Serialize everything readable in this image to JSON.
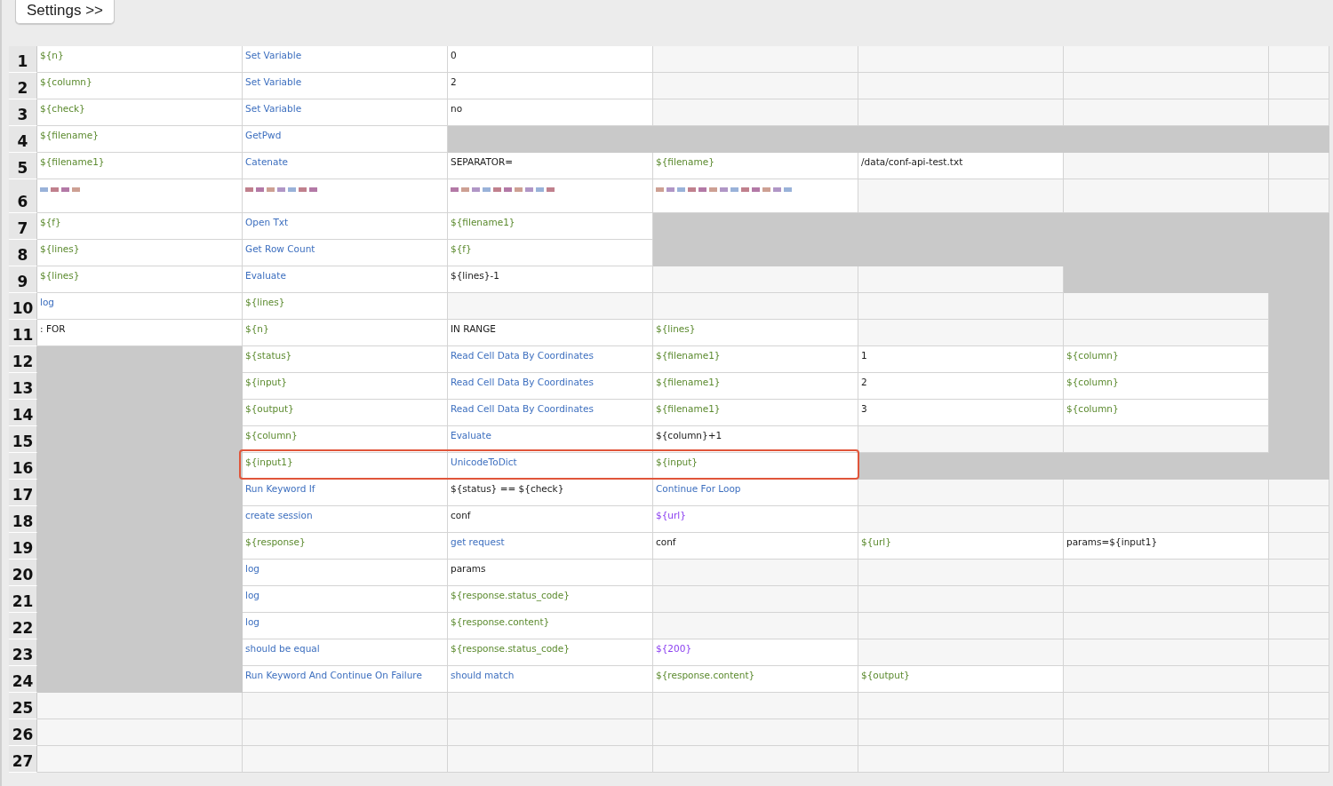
{
  "settings_button": "Settings >>",
  "rows": [
    {
      "number": "1",
      "cells": [
        {
          "text": "${n}",
          "kind": "variable",
          "shaded": false,
          "highlighted": false
        },
        {
          "text": "Set Variable",
          "kind": "keyword",
          "shaded": false,
          "highlighted": false
        },
        {
          "text": "0",
          "kind": "plain",
          "shaded": false,
          "highlighted": false
        },
        {
          "shaded": false,
          "highlighted": false
        },
        {
          "shaded": false,
          "highlighted": false
        },
        {
          "shaded": false,
          "highlighted": false
        },
        {
          "shaded": false,
          "highlighted": false
        }
      ]
    },
    {
      "number": "2",
      "cells": [
        {
          "text": "${column}",
          "kind": "variable",
          "shaded": false,
          "highlighted": false
        },
        {
          "text": "Set Variable",
          "kind": "keyword",
          "shaded": false,
          "highlighted": false
        },
        {
          "text": "2",
          "kind": "plain",
          "shaded": false,
          "highlighted": false
        },
        {
          "shaded": false,
          "highlighted": false
        },
        {
          "shaded": false,
          "highlighted": false
        },
        {
          "shaded": false,
          "highlighted": false
        },
        {
          "shaded": false,
          "highlighted": false
        }
      ]
    },
    {
      "number": "3",
      "cells": [
        {
          "text": "${check}",
          "kind": "variable",
          "shaded": false,
          "highlighted": false
        },
        {
          "text": "Set Variable",
          "kind": "keyword",
          "shaded": false,
          "highlighted": false
        },
        {
          "text": "no",
          "kind": "plain",
          "shaded": false,
          "highlighted": false
        },
        {
          "shaded": false,
          "highlighted": false
        },
        {
          "shaded": false,
          "highlighted": false
        },
        {
          "shaded": false,
          "highlighted": false
        },
        {
          "shaded": false,
          "highlighted": false
        }
      ]
    },
    {
      "number": "4",
      "cells": [
        {
          "text": "${filename}",
          "kind": "variable",
          "shaded": false,
          "highlighted": false
        },
        {
          "text": "GetPwd",
          "kind": "keyword",
          "shaded": false,
          "highlighted": false
        },
        {
          "shaded": true,
          "highlighted": false
        },
        {
          "shaded": true,
          "highlighted": false
        },
        {
          "shaded": true,
          "highlighted": false
        },
        {
          "shaded": true,
          "highlighted": false
        },
        {
          "shaded": true,
          "highlighted": false
        }
      ]
    },
    {
      "number": "5",
      "cells": [
        {
          "text": "${filename1}",
          "kind": "variable",
          "shaded": false,
          "highlighted": false
        },
        {
          "text": "Catenate",
          "kind": "keyword",
          "shaded": false,
          "highlighted": false
        },
        {
          "text": "SEPARATOR=",
          "kind": "plain",
          "shaded": false,
          "highlighted": false
        },
        {
          "text": "${filename}",
          "kind": "variable",
          "shaded": false,
          "highlighted": false
        },
        {
          "text": "/data/conf-api-test.txt",
          "kind": "plain",
          "shaded": false,
          "highlighted": false
        },
        {
          "shaded": false,
          "highlighted": false
        },
        {
          "shaded": false,
          "highlighted": false
        }
      ]
    },
    {
      "number": "6",
      "tall": true,
      "cells": [
        {
          "kind": "redacted",
          "shaded": false,
          "highlighted": false
        },
        {
          "kind": "redacted",
          "shaded": false,
          "highlighted": false
        },
        {
          "kind": "redacted",
          "shaded": false,
          "highlighted": false
        },
        {
          "kind": "redacted",
          "shaded": false,
          "highlighted": false
        },
        {
          "shaded": false,
          "highlighted": false
        },
        {
          "shaded": false,
          "highlighted": false
        },
        {
          "shaded": false,
          "highlighted": false
        }
      ]
    },
    {
      "number": "7",
      "cells": [
        {
          "text": "${f}",
          "kind": "variable",
          "shaded": false,
          "highlighted": false
        },
        {
          "text": "Open Txt",
          "kind": "keyword",
          "shaded": false,
          "highlighted": false
        },
        {
          "text": "${filename1}",
          "kind": "variable",
          "shaded": false,
          "highlighted": false
        },
        {
          "shaded": true,
          "highlighted": false
        },
        {
          "shaded": true,
          "highlighted": false
        },
        {
          "shaded": true,
          "highlighted": false
        },
        {
          "shaded": true,
          "highlighted": false
        }
      ]
    },
    {
      "number": "8",
      "cells": [
        {
          "text": "${lines}",
          "kind": "variable",
          "shaded": false,
          "highlighted": false
        },
        {
          "text": "Get Row Count",
          "kind": "keyword",
          "shaded": false,
          "highlighted": false
        },
        {
          "text": "${f}",
          "kind": "variable",
          "shaded": false,
          "highlighted": false
        },
        {
          "shaded": true,
          "highlighted": false
        },
        {
          "shaded": true,
          "highlighted": false
        },
        {
          "shaded": true,
          "highlighted": false
        },
        {
          "shaded": true,
          "highlighted": false
        }
      ]
    },
    {
      "number": "9",
      "cells": [
        {
          "text": "${lines}",
          "kind": "variable",
          "shaded": false,
          "highlighted": false
        },
        {
          "text": "Evaluate",
          "kind": "keyword",
          "shaded": false,
          "highlighted": false
        },
        {
          "text": "${lines}-1",
          "kind": "plain",
          "shaded": false,
          "highlighted": false
        },
        {
          "shaded": false,
          "highlighted": false
        },
        {
          "shaded": false,
          "highlighted": false
        },
        {
          "shaded": true,
          "highlighted": false
        },
        {
          "shaded": true,
          "highlighted": false
        }
      ]
    },
    {
      "number": "10",
      "cells": [
        {
          "text": "log",
          "kind": "keyword",
          "shaded": false,
          "highlighted": false
        },
        {
          "text": "${lines}",
          "kind": "variable",
          "shaded": false,
          "highlighted": false
        },
        {
          "shaded": false,
          "highlighted": false
        },
        {
          "shaded": false,
          "highlighted": false
        },
        {
          "shaded": false,
          "highlighted": false
        },
        {
          "shaded": false,
          "highlighted": false
        },
        {
          "shaded": true,
          "highlighted": false
        }
      ]
    },
    {
      "number": "11",
      "cells": [
        {
          "text": ": FOR",
          "kind": "plain",
          "shaded": false,
          "highlighted": false
        },
        {
          "text": "${n}",
          "kind": "variable",
          "shaded": false,
          "highlighted": false
        },
        {
          "text": "IN RANGE",
          "kind": "plain",
          "shaded": false,
          "highlighted": false
        },
        {
          "text": "${lines}",
          "kind": "variable",
          "shaded": false,
          "highlighted": false
        },
        {
          "shaded": false,
          "highlighted": false
        },
        {
          "shaded": false,
          "highlighted": false
        },
        {
          "shaded": true,
          "highlighted": false
        }
      ]
    },
    {
      "number": "12",
      "cells": [
        {
          "shaded": true,
          "highlighted": false
        },
        {
          "text": "${status}",
          "kind": "variable",
          "shaded": false,
          "highlighted": false
        },
        {
          "text": "Read Cell Data By Coordinates",
          "kind": "keyword",
          "shaded": false,
          "highlighted": false
        },
        {
          "text": "${filename1}",
          "kind": "variable",
          "shaded": false,
          "highlighted": false
        },
        {
          "text": "1",
          "kind": "plain",
          "shaded": false,
          "highlighted": false
        },
        {
          "text": "${column}",
          "kind": "variable",
          "shaded": false,
          "highlighted": false
        },
        {
          "shaded": true,
          "highlighted": false
        }
      ]
    },
    {
      "number": "13",
      "cells": [
        {
          "shaded": true,
          "highlighted": false
        },
        {
          "text": "${input}",
          "kind": "variable",
          "shaded": false,
          "highlighted": false
        },
        {
          "text": "Read Cell Data By Coordinates",
          "kind": "keyword",
          "shaded": false,
          "highlighted": false
        },
        {
          "text": "${filename1}",
          "kind": "variable",
          "shaded": false,
          "highlighted": false
        },
        {
          "text": "2",
          "kind": "plain",
          "shaded": false,
          "highlighted": false
        },
        {
          "text": "${column}",
          "kind": "variable",
          "shaded": false,
          "highlighted": false
        },
        {
          "shaded": true,
          "highlighted": false
        }
      ]
    },
    {
      "number": "14",
      "cells": [
        {
          "shaded": true,
          "highlighted": false
        },
        {
          "text": "${output}",
          "kind": "variable",
          "shaded": false,
          "highlighted": false
        },
        {
          "text": "Read Cell Data By Coordinates",
          "kind": "keyword",
          "shaded": false,
          "highlighted": false
        },
        {
          "text": "${filename1}",
          "kind": "variable",
          "shaded": false,
          "highlighted": false
        },
        {
          "text": "3",
          "kind": "plain",
          "shaded": false,
          "highlighted": false
        },
        {
          "text": "${column}",
          "kind": "variable",
          "shaded": false,
          "highlighted": false
        },
        {
          "shaded": true,
          "highlighted": false
        }
      ]
    },
    {
      "number": "15",
      "cells": [
        {
          "shaded": true,
          "highlighted": false
        },
        {
          "text": "${column}",
          "kind": "variable",
          "shaded": false,
          "highlighted": false
        },
        {
          "text": "Evaluate",
          "kind": "keyword",
          "shaded": false,
          "highlighted": false
        },
        {
          "text": "${column}+1",
          "kind": "plain",
          "shaded": false,
          "highlighted": false
        },
        {
          "shaded": false,
          "highlighted": false
        },
        {
          "shaded": false,
          "highlighted": false
        },
        {
          "shaded": true,
          "highlighted": false
        }
      ]
    },
    {
      "number": "16",
      "cells": [
        {
          "shaded": true,
          "highlighted": false
        },
        {
          "text": "${input1}",
          "kind": "variable",
          "shaded": false,
          "highlighted": true
        },
        {
          "text": "UnicodeToDict",
          "kind": "keyword",
          "shaded": false,
          "highlighted": true
        },
        {
          "text": "${input}",
          "kind": "variable",
          "shaded": false,
          "highlighted": true
        },
        {
          "shaded": true,
          "highlighted": false
        },
        {
          "shaded": true,
          "highlighted": false
        },
        {
          "shaded": true,
          "highlighted": false
        }
      ]
    },
    {
      "number": "17",
      "cells": [
        {
          "shaded": true,
          "highlighted": false
        },
        {
          "text": "Run Keyword If",
          "kind": "keyword",
          "shaded": false,
          "highlighted": false
        },
        {
          "text": "${status} == ${check}",
          "kind": "plain",
          "shaded": false,
          "highlighted": false
        },
        {
          "text": "Continue For Loop",
          "kind": "keyword",
          "shaded": false,
          "highlighted": false
        },
        {
          "shaded": false,
          "highlighted": false
        },
        {
          "shaded": false,
          "highlighted": false
        },
        {
          "shaded": false,
          "highlighted": false
        }
      ]
    },
    {
      "number": "18",
      "cells": [
        {
          "shaded": true,
          "highlighted": false
        },
        {
          "text": "create session",
          "kind": "keyword",
          "shaded": false,
          "highlighted": false
        },
        {
          "text": "conf",
          "kind": "plain",
          "shaded": false,
          "highlighted": false
        },
        {
          "text": "${url}",
          "kind": "unknown_variable",
          "shaded": false,
          "highlighted": false
        },
        {
          "shaded": false,
          "highlighted": false
        },
        {
          "shaded": false,
          "highlighted": false
        },
        {
          "shaded": false,
          "highlighted": false
        }
      ]
    },
    {
      "number": "19",
      "cells": [
        {
          "shaded": true,
          "highlighted": false
        },
        {
          "text": "${response}",
          "kind": "variable",
          "shaded": false,
          "highlighted": false
        },
        {
          "text": "get request",
          "kind": "keyword",
          "shaded": false,
          "highlighted": false
        },
        {
          "text": "conf",
          "kind": "plain",
          "shaded": false,
          "highlighted": false
        },
        {
          "text": "${url}",
          "kind": "variable",
          "shaded": false,
          "highlighted": false
        },
        {
          "text": "params=${input1}",
          "kind": "plain",
          "shaded": false,
          "highlighted": false
        },
        {
          "shaded": false,
          "highlighted": false
        }
      ]
    },
    {
      "number": "20",
      "cells": [
        {
          "shaded": true,
          "highlighted": false
        },
        {
          "text": "log",
          "kind": "keyword",
          "shaded": false,
          "highlighted": false
        },
        {
          "text": "params",
          "kind": "plain",
          "shaded": false,
          "highlighted": false
        },
        {
          "shaded": false,
          "highlighted": false
        },
        {
          "shaded": false,
          "highlighted": false
        },
        {
          "shaded": false,
          "highlighted": false
        },
        {
          "shaded": false,
          "highlighted": false
        }
      ]
    },
    {
      "number": "21",
      "cells": [
        {
          "shaded": true,
          "highlighted": false
        },
        {
          "text": "log",
          "kind": "keyword",
          "shaded": false,
          "highlighted": false
        },
        {
          "text": "${response.status_code}",
          "kind": "variable",
          "shaded": false,
          "highlighted": false
        },
        {
          "shaded": false,
          "highlighted": false
        },
        {
          "shaded": false,
          "highlighted": false
        },
        {
          "shaded": false,
          "highlighted": false
        },
        {
          "shaded": false,
          "highlighted": false
        }
      ]
    },
    {
      "number": "22",
      "cells": [
        {
          "shaded": true,
          "highlighted": false
        },
        {
          "text": "log",
          "kind": "keyword",
          "shaded": false,
          "highlighted": false
        },
        {
          "text": "${response.content}",
          "kind": "variable",
          "shaded": false,
          "highlighted": false
        },
        {
          "shaded": false,
          "highlighted": false
        },
        {
          "shaded": false,
          "highlighted": false
        },
        {
          "shaded": false,
          "highlighted": false
        },
        {
          "shaded": false,
          "highlighted": false
        }
      ]
    },
    {
      "number": "23",
      "cells": [
        {
          "shaded": true,
          "highlighted": false
        },
        {
          "text": "should be equal",
          "kind": "keyword",
          "shaded": false,
          "highlighted": false
        },
        {
          "text": "${response.status_code}",
          "kind": "variable",
          "shaded": false,
          "highlighted": false
        },
        {
          "text": "${200}",
          "kind": "unknown_variable",
          "shaded": false,
          "highlighted": false
        },
        {
          "shaded": false,
          "highlighted": false
        },
        {
          "shaded": false,
          "highlighted": false
        },
        {
          "shaded": false,
          "highlighted": false
        }
      ]
    },
    {
      "number": "24",
      "cells": [
        {
          "shaded": true,
          "highlighted": false
        },
        {
          "text": "Run Keyword And Continue On Failure",
          "kind": "keyword",
          "shaded": false,
          "highlighted": false
        },
        {
          "text": "should match",
          "kind": "keyword",
          "shaded": false,
          "highlighted": false
        },
        {
          "text": "${response.content}",
          "kind": "variable",
          "shaded": false,
          "highlighted": false
        },
        {
          "text": "${output}",
          "kind": "variable",
          "shaded": false,
          "highlighted": false
        },
        {
          "shaded": false,
          "highlighted": false
        },
        {
          "shaded": false,
          "highlighted": false
        }
      ]
    },
    {
      "number": "25",
      "cells": [
        {
          "shaded": false,
          "highlighted": false
        },
        {
          "shaded": false,
          "highlighted": false
        },
        {
          "shaded": false,
          "highlighted": false
        },
        {
          "shaded": false,
          "highlighted": false
        },
        {
          "shaded": false,
          "highlighted": false
        },
        {
          "shaded": false,
          "highlighted": false
        },
        {
          "shaded": false,
          "highlighted": false
        }
      ]
    },
    {
      "number": "26",
      "cells": [
        {
          "shaded": false,
          "highlighted": false
        },
        {
          "shaded": false,
          "highlighted": false
        },
        {
          "shaded": false,
          "highlighted": false
        },
        {
          "shaded": false,
          "highlighted": false
        },
        {
          "shaded": false,
          "highlighted": false
        },
        {
          "shaded": false,
          "highlighted": false
        },
        {
          "shaded": false,
          "highlighted": false
        }
      ]
    },
    {
      "number": "27",
      "cells": [
        {
          "shaded": false,
          "highlighted": false
        },
        {
          "shaded": false,
          "highlighted": false
        },
        {
          "shaded": false,
          "highlighted": false
        },
        {
          "shaded": false,
          "highlighted": false
        },
        {
          "shaded": false,
          "highlighted": false
        },
        {
          "shaded": false,
          "highlighted": false
        },
        {
          "shaded": false,
          "highlighted": false
        }
      ]
    }
  ]
}
